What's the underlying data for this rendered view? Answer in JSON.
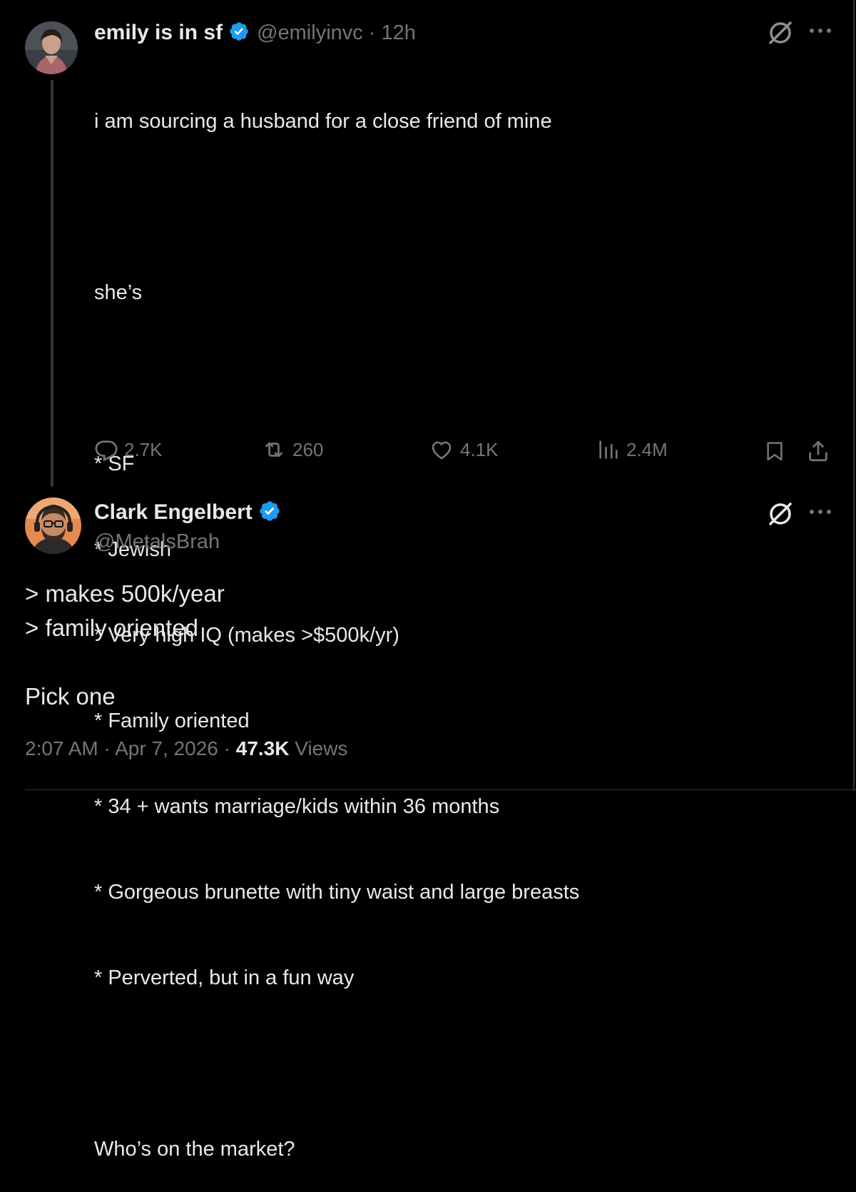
{
  "tweet": {
    "author_name": "emily is in sf",
    "author_handle": "@emilyinvc",
    "separator": "·",
    "time": "12h",
    "lines": [
      "i am sourcing a husband for a close friend of mine",
      "",
      "she’s",
      "",
      "* SF",
      "* Jewish",
      "* Very high IQ (makes >$500k/yr)",
      "* Family oriented",
      "* 34 + wants marriage/kids within 36 months",
      "* Gorgeous brunette with tiny waist and large breasts",
      "* Perverted, but in a fun way",
      "",
      "Who’s on the market?"
    ],
    "stats": {
      "replies": "2.7K",
      "reposts": "260",
      "likes": "4.1K",
      "views": "2.4M"
    }
  },
  "reply": {
    "author_name": "Clark Engelbert",
    "author_handle": "@MetalsBrah",
    "lines": [
      "> makes 500k/year",
      "> family oriented",
      "",
      "Pick one"
    ],
    "time": "2:07 AM",
    "separator": "·",
    "date": "Apr 7, 2026",
    "views_count": "47.3K",
    "views_label": "Views"
  },
  "colors": {
    "background": "#000000",
    "text": "#e7e9ea",
    "muted": "#71767b",
    "verified": "#1d9bf0"
  },
  "icons": [
    "verified-badge-icon",
    "grok-icon",
    "more-icon",
    "reply-icon",
    "repost-icon",
    "like-icon",
    "views-icon",
    "bookmark-icon",
    "share-icon"
  ]
}
